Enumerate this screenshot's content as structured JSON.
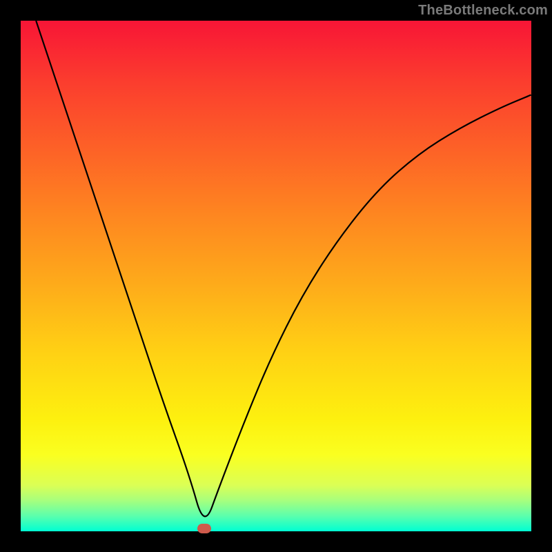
{
  "watermark": "TheBottleneck.com",
  "marker": {
    "color": "#cf5b4c",
    "x_frac": 0.3595,
    "y_frac": 0.994
  },
  "chart_data": {
    "type": "line",
    "title": "",
    "xlabel": "",
    "ylabel": "",
    "xlim": [
      0,
      1
    ],
    "ylim": [
      0,
      1
    ],
    "series": [
      {
        "name": "curve",
        "x": [
          0.03,
          0.08,
          0.13,
          0.18,
          0.23,
          0.28,
          0.33,
          0.3595,
          0.39,
          0.44,
          0.49,
          0.55,
          0.62,
          0.7,
          0.78,
          0.86,
          0.94,
          1.0
        ],
        "y": [
          1.0,
          0.85,
          0.7,
          0.55,
          0.4,
          0.25,
          0.11,
          0.006,
          0.09,
          0.22,
          0.34,
          0.46,
          0.57,
          0.67,
          0.74,
          0.79,
          0.83,
          0.855
        ]
      }
    ],
    "gradient_stops": [
      {
        "pos": 0.0,
        "color": "#f81536"
      },
      {
        "pos": 0.5,
        "color": "#feac1a"
      },
      {
        "pos": 0.82,
        "color": "#fdf00f"
      },
      {
        "pos": 1.0,
        "color": "#00ffd3"
      }
    ]
  }
}
